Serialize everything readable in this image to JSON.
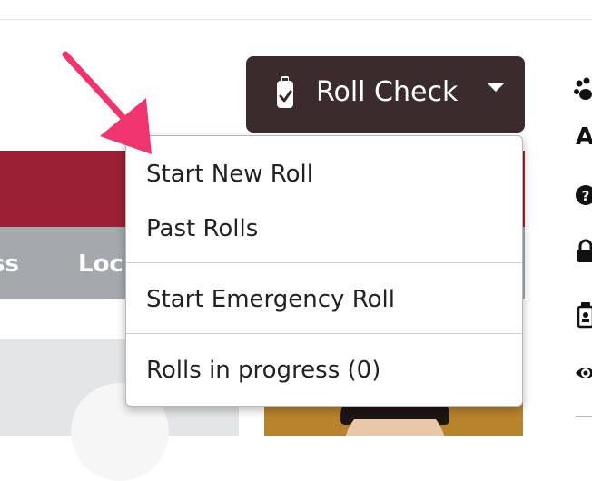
{
  "roll_button": {
    "label": "Roll Check"
  },
  "menu": {
    "items": [
      {
        "label": "Start New Roll"
      },
      {
        "label": "Past Rolls"
      },
      {
        "label": "Start Emergency Roll"
      },
      {
        "label": "Rolls in progress (0)"
      }
    ]
  },
  "nav": {
    "item_a": "ss",
    "item_b": "Loc"
  },
  "sidebar": {
    "letter": "A"
  },
  "colors": {
    "button_bg": "#3a2c2c",
    "banner_red": "#9b1f35",
    "nav_grey": "#a3a9ad",
    "arrow_pink": "#f0346e"
  },
  "icons": {
    "button": "clipboard-check-icon",
    "caret": "caret-down-icon",
    "side": [
      "paw-icon",
      "question-circle-icon",
      "lock-icon",
      "id-badge-icon",
      "eye-icon"
    ]
  }
}
